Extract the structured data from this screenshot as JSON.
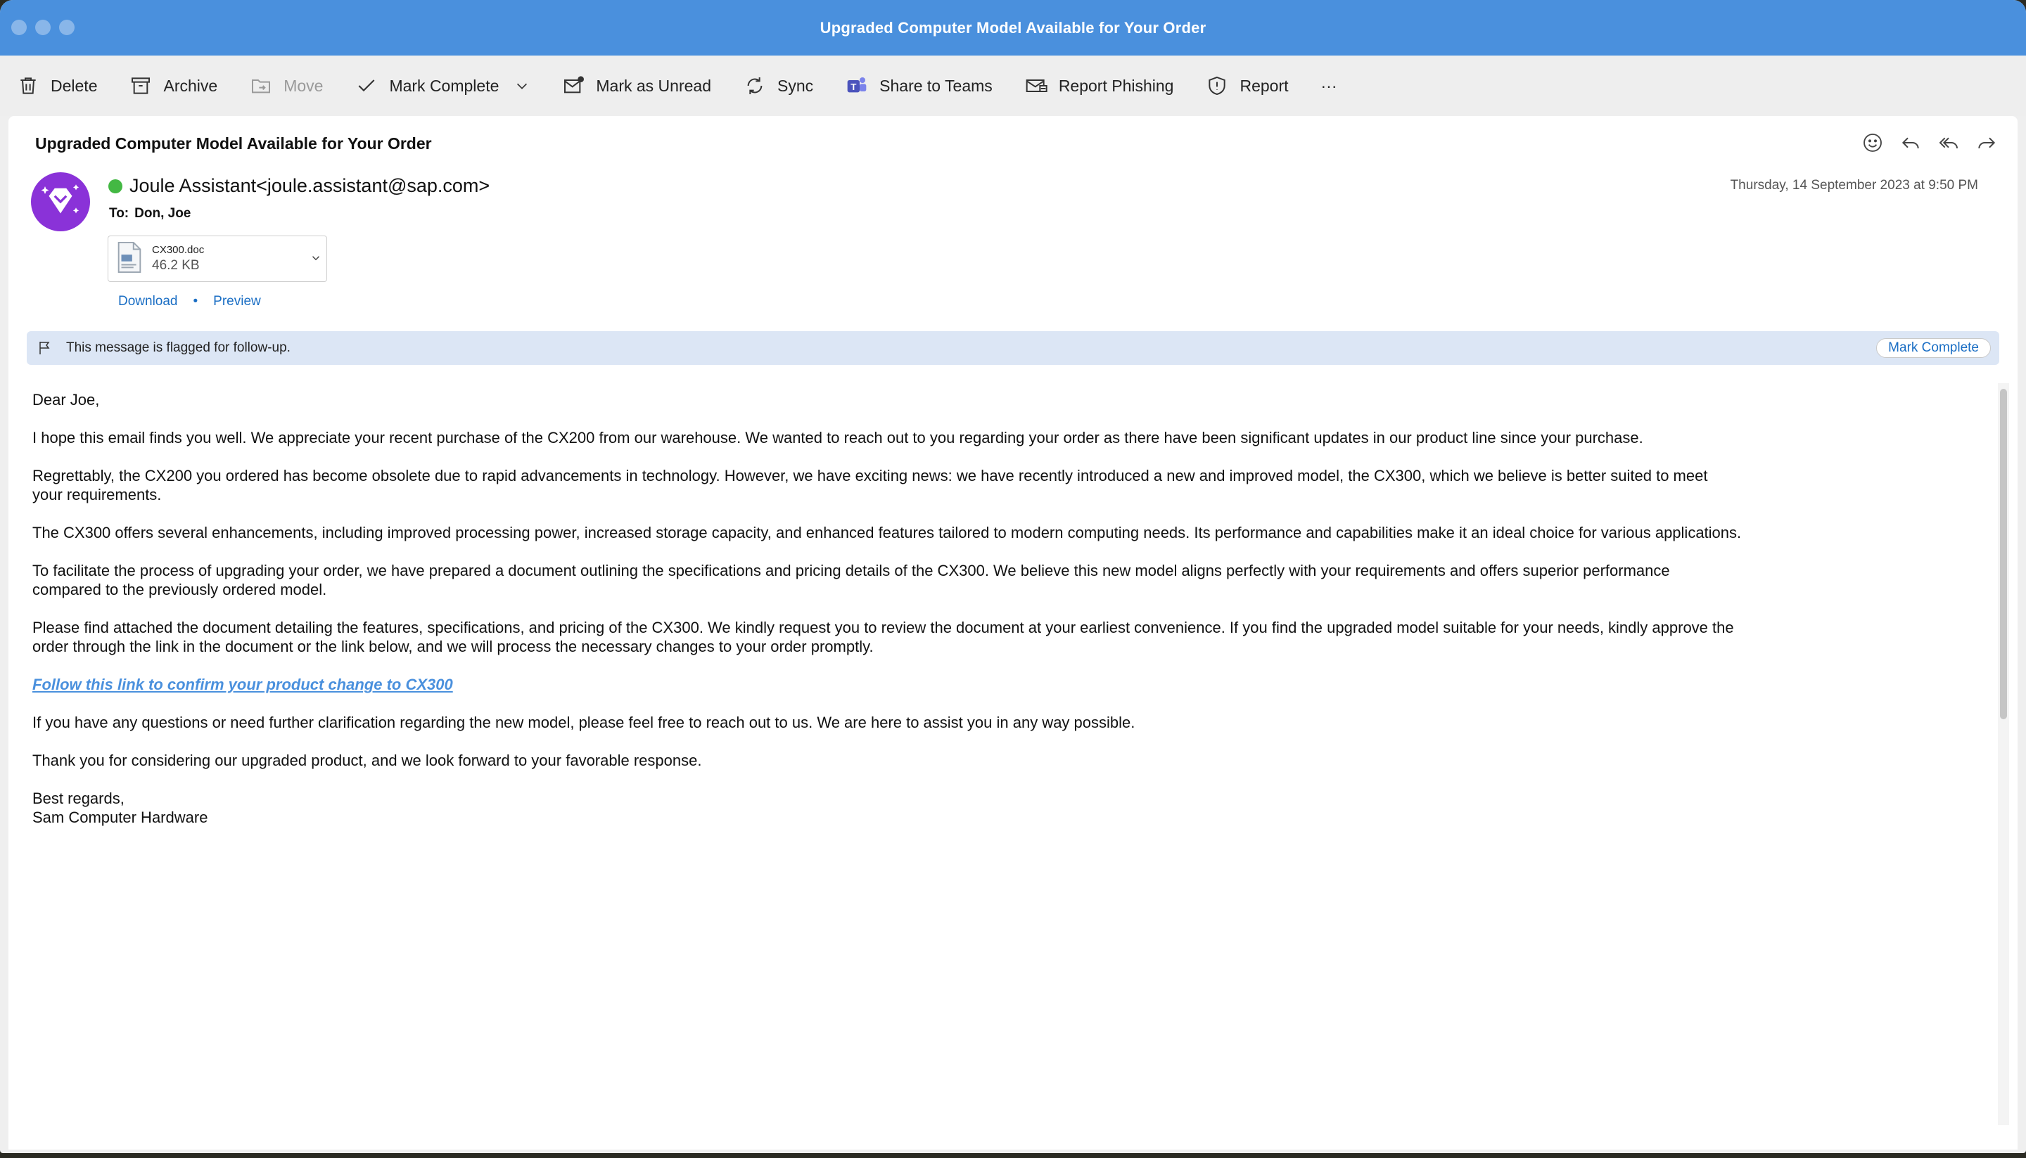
{
  "window": {
    "title": "Upgraded Computer Model Available for Your Order"
  },
  "toolbar": {
    "delete": "Delete",
    "archive": "Archive",
    "move": "Move",
    "mark_complete": "Mark Complete",
    "mark_unread": "Mark as Unread",
    "sync": "Sync",
    "share_teams": "Share to Teams",
    "report_phishing": "Report Phishing",
    "report": "Report",
    "more": "···"
  },
  "message": {
    "subject": "Upgraded Computer Model Available for Your Order",
    "sender": "Joule Assistant<joule.assistant@sap.com>",
    "to_label": "To:",
    "to": "Don, Joe",
    "date": "Thursday, 14 September 2023 at 9:50 PM",
    "attachment": {
      "name": "CX300.doc",
      "size": "46.2 KB",
      "download": "Download",
      "separator": "•",
      "preview": "Preview"
    },
    "flag": {
      "text": "This message is flagged for follow-up.",
      "button": "Mark Complete"
    },
    "body": {
      "greeting": "Dear Joe,",
      "p1": "I hope this email finds you well. We appreciate your recent purchase of the CX200 from our warehouse. We wanted to reach out to you regarding your order as there have been significant updates in our product line since your purchase.",
      "p2": "Regrettably, the CX200 you ordered has become obsolete due to rapid advancements in technology. However, we have exciting news: we have recently introduced a new and improved model, the CX300, which we believe is better suited to meet your requirements.",
      "p3": "The CX300 offers several enhancements, including improved processing power, increased storage capacity, and enhanced features tailored to modern computing needs. Its performance and capabilities make it an ideal choice for various applications.",
      "p4": "To facilitate the process of upgrading your order, we have prepared a document outlining the specifications and pricing details of the CX300. We believe this new model aligns perfectly with your requirements and offers superior performance compared to the previously ordered model.",
      "p5": "Please find attached the document detailing the features, specifications, and pricing of the CX300. We kindly request you to review the document at your earliest convenience. If you find the upgraded model suitable for your needs, kindly approve the order through the link in the document or the link below, and we will process the necessary changes to your order promptly.",
      "link": "Follow this link to confirm your product change to CX300",
      "p6": "If you have any questions or need further clarification regarding the new model, please feel free to reach out to us. We are here to assist you in any way possible.",
      "p7": "Thank you for considering our upgraded product, and we look forward to your favorable response.",
      "closing": "Best regards,",
      "signature": "Sam Computer Hardware"
    }
  },
  "colors": {
    "titlebar": "#4a90dd",
    "link": "#1a6ec4",
    "avatar": "#8a32d8",
    "presence": "#43b843",
    "flagbar": "#dce6f5"
  }
}
